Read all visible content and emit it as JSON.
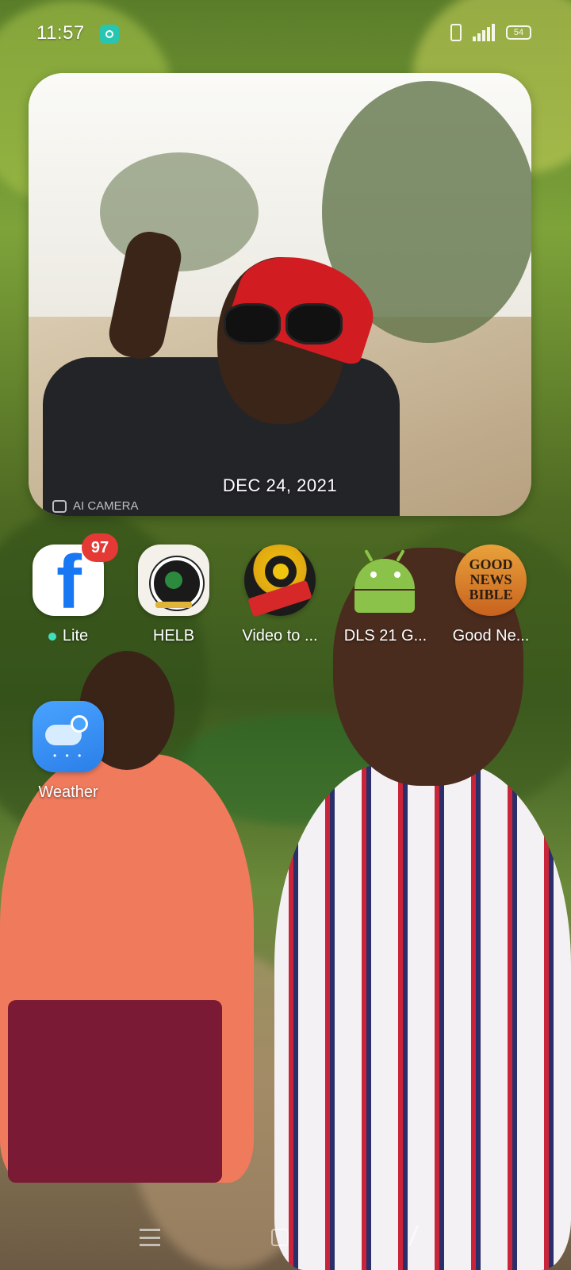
{
  "status_bar": {
    "time": "11:57",
    "battery": "54"
  },
  "photo_widget": {
    "date": "DEC 24, 2021",
    "watermark": "AI CAMERA"
  },
  "apps": [
    {
      "label": "Lite",
      "badge": "97",
      "icon": "facebook-lite-icon",
      "new_dot": true
    },
    {
      "label": "HELB",
      "icon": "helb-icon"
    },
    {
      "label": "Video to ...",
      "icon": "video-reel-icon"
    },
    {
      "label": "DLS 21 G...",
      "icon": "android-icon"
    },
    {
      "label": "Good Ne...",
      "icon": "good-news-bible-icon"
    },
    {
      "label": "Weather",
      "icon": "weather-icon"
    }
  ],
  "bible_icon_text": "GOOD NEWS BIBLE",
  "fb_icon_letter": "f",
  "colors": {
    "facebook_blue": "#1877f2",
    "badge_red": "#e53935",
    "weather_blue": "#2a7fe8",
    "android_green": "#8bc34a"
  }
}
